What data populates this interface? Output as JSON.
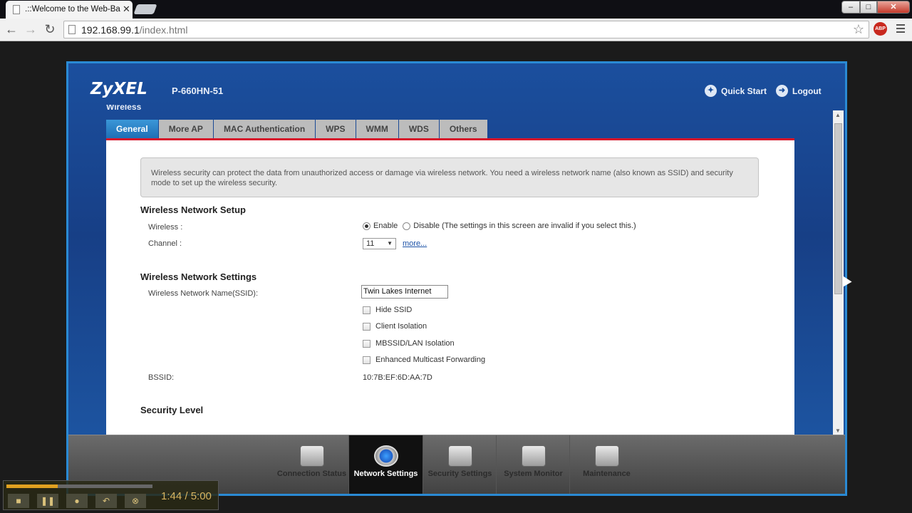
{
  "browser": {
    "tab_title": ".::Welcome to the Web-Ba",
    "tab_close": "✕",
    "url_host": "192.168.99.1",
    "url_path": "/index.html",
    "abp_label": "ABP",
    "window_min": "–",
    "window_max": "□",
    "window_close": "✕",
    "back": "←",
    "forward": "→",
    "reload": "↻",
    "star": "☆"
  },
  "header": {
    "logo": "ZyXEL",
    "model": "P-660HN-51",
    "quick_start": "Quick Start",
    "logout": "Logout",
    "section": "Wireless"
  },
  "tabs": [
    {
      "label": "General"
    },
    {
      "label": "More AP"
    },
    {
      "label": "MAC Authentication"
    },
    {
      "label": "WPS"
    },
    {
      "label": "WMM"
    },
    {
      "label": "WDS"
    },
    {
      "label": "Others"
    }
  ],
  "info_text": "Wireless security can protect the data from unauthorized access or damage via wireless network. You need a wireless network name (also known as SSID) and security mode to set up the wireless security.",
  "setup": {
    "heading": "Wireless Network Setup",
    "wireless_label": "Wireless :",
    "enable": "Enable",
    "disable": "Disable (The settings in this screen are invalid if you select this.)",
    "wireless_enabled": true,
    "channel_label": "Channel :",
    "channel_value": "11",
    "more": "more..."
  },
  "settings": {
    "heading": "Wireless Network Settings",
    "ssid_label": "Wireless Network Name(SSID):",
    "ssid_value": "Twin Lakes Internet",
    "hide_ssid": "Hide SSID",
    "client_isolation": "Client Isolation",
    "mbssid": "MBSSID/LAN Isolation",
    "multicast": "Enhanced Multicast Forwarding",
    "bssid_label": "BSSID:",
    "bssid_value": "10:7B:EF:6D:AA:7D"
  },
  "security_heading": "Security Level",
  "dock": [
    {
      "label": "Connection Status",
      "icon": "monitor-icon"
    },
    {
      "label": "Network Settings",
      "icon": "globe-gear-icon",
      "active": true
    },
    {
      "label": "Security Settings",
      "icon": "shield-icon"
    },
    {
      "label": "System Monitor",
      "icon": "chart-icon"
    },
    {
      "label": "Maintenance",
      "icon": "toolbox-icon"
    }
  ],
  "video": {
    "time": "1:44 / 5:00",
    "progress": 0.35
  },
  "colors": {
    "accent": "#2a8ad4",
    "active_tab": "#1e6fb5",
    "red_line": "#d7142a"
  }
}
